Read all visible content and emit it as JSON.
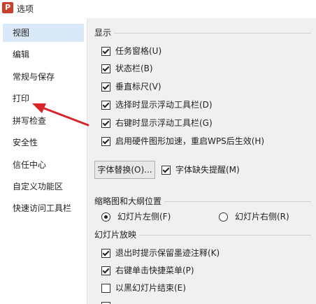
{
  "window": {
    "title": "选项",
    "app_icon_letter": "P"
  },
  "sidebar": {
    "items": [
      {
        "label": "视图",
        "selected": true
      },
      {
        "label": "编辑"
      },
      {
        "label": "常规与保存"
      },
      {
        "label": "打印"
      },
      {
        "label": "拼写检查"
      },
      {
        "label": "安全性"
      },
      {
        "label": "信任中心"
      },
      {
        "label": "自定义功能区"
      },
      {
        "label": "快速访问工具栏"
      }
    ]
  },
  "display": {
    "title": "显示",
    "options": [
      {
        "label": "任务窗格(U)",
        "checked": true
      },
      {
        "label": "状态栏(B)",
        "checked": true
      },
      {
        "label": "垂直标尺(V)",
        "checked": true
      },
      {
        "label": "选择时显示浮动工具栏(D)",
        "checked": true
      },
      {
        "label": "右键时显示浮动工具栏(G)",
        "checked": true
      },
      {
        "label": "启用硬件图形加速，重启WPS后生效(H)",
        "checked": true
      }
    ],
    "font_replace_button": "字体替换(O)...",
    "missing_font_alert": {
      "label": "字体缺失提醒(M)",
      "checked": true
    }
  },
  "thumbnail": {
    "title": "缩略图和大纲位置",
    "left": {
      "label": "幻灯片左侧(F)",
      "checked": true
    },
    "right": {
      "label": "幻灯片右侧(R)",
      "checked": false
    }
  },
  "slideshow": {
    "title": "幻灯片放映",
    "options": [
      {
        "label": "退出时提示保留墨迹注释(K)",
        "checked": true
      },
      {
        "label": "右键单击快捷菜单(P)",
        "checked": true
      },
      {
        "label": "以黑幻灯片结束(E)",
        "checked": false
      }
    ]
  },
  "colors": {
    "selected_bg": "#d9e9f7",
    "arrow": "#d7252b",
    "app_icon": "#c9402c"
  }
}
